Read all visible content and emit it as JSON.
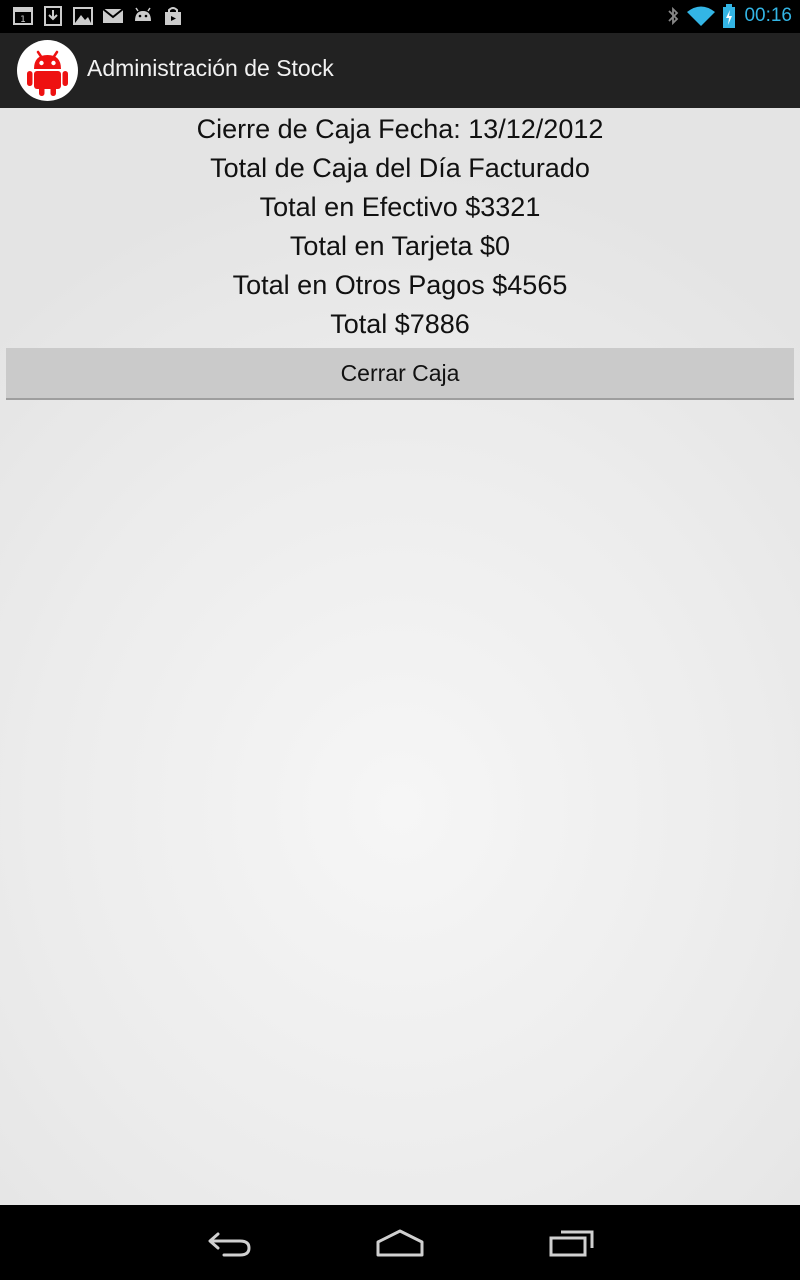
{
  "status_bar": {
    "clock": "00:16",
    "notification_icons": [
      "calendar-icon",
      "download-icon",
      "image-icon",
      "gmail-icon",
      "android-icon",
      "shopping-bag-icon"
    ],
    "system_icons": [
      "bluetooth-icon",
      "wifi-icon",
      "battery-charging-icon"
    ],
    "accent_color": "#33b5e5"
  },
  "action_bar": {
    "title": "Administración de Stock",
    "icon": "android-logo-icon"
  },
  "summary": {
    "line1": "Cierre de Caja Fecha: 13/12/2012",
    "line2": "Total de Caja del Día Facturado",
    "line3": "Total en Efectivo $3321",
    "line4": "Total en Tarjeta $0",
    "line5": "Total en Otros Pagos $4565",
    "line6": "Total $7886"
  },
  "actions": {
    "close_button_label": "Cerrar Caja"
  },
  "nav_bar": {
    "buttons": [
      "back-icon",
      "home-icon",
      "recent-apps-icon"
    ]
  }
}
